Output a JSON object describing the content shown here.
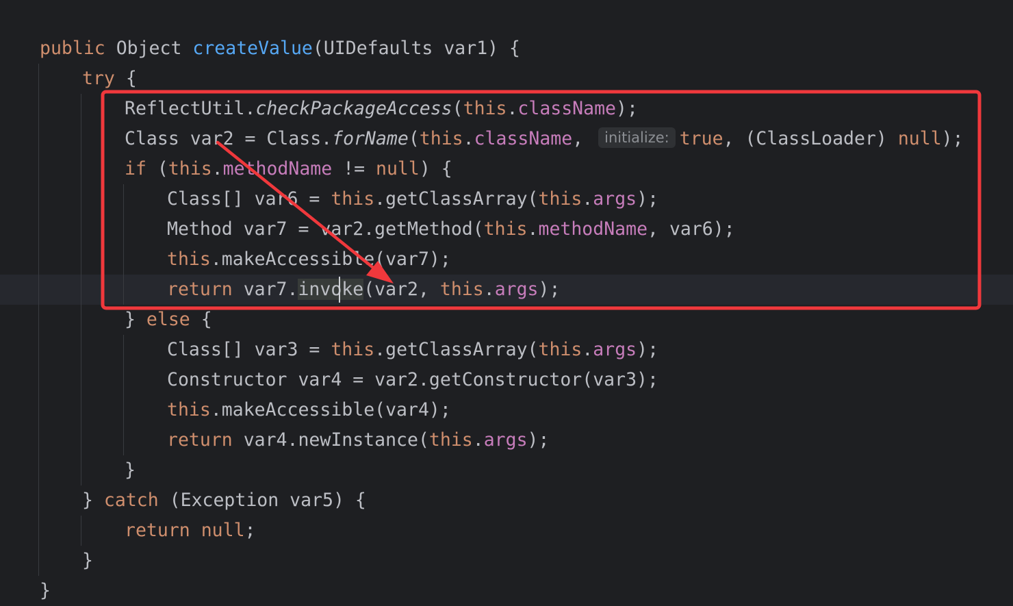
{
  "annotation": {
    "color": "#f0383c"
  },
  "code": {
    "lines": [
      {
        "indent": 0,
        "tokens": [
          {
            "t": "public",
            "c": "kw"
          },
          {
            "t": " Object ",
            "c": "plain"
          },
          {
            "t": "createValue",
            "c": "fn"
          },
          {
            "t": "(UIDefaults var1) {",
            "c": "plain"
          }
        ]
      },
      {
        "indent": 1,
        "tokens": [
          {
            "t": "try",
            "c": "kw"
          },
          {
            "t": " {",
            "c": "plain"
          }
        ]
      },
      {
        "indent": 2,
        "tokens": [
          {
            "t": "ReflectUtil.",
            "c": "plain"
          },
          {
            "t": "checkPackageAccess",
            "c": "static"
          },
          {
            "t": "(",
            "c": "plain"
          },
          {
            "t": "this",
            "c": "kw"
          },
          {
            "t": ".",
            "c": "plain"
          },
          {
            "t": "className",
            "c": "field"
          },
          {
            "t": ");",
            "c": "plain"
          }
        ]
      },
      {
        "indent": 2,
        "tokens": [
          {
            "t": "Class var2 = Class.",
            "c": "plain"
          },
          {
            "t": "forName",
            "c": "static"
          },
          {
            "t": "(",
            "c": "plain"
          },
          {
            "t": "this",
            "c": "kw"
          },
          {
            "t": ".",
            "c": "plain"
          },
          {
            "t": "className",
            "c": "field"
          },
          {
            "t": ", ",
            "c": "plain"
          },
          {
            "t": "initialize:",
            "c": "hint"
          },
          {
            "t": "true",
            "c": "kw"
          },
          {
            "t": ", (ClassLoader) ",
            "c": "plain"
          },
          {
            "t": "null",
            "c": "kw"
          },
          {
            "t": ");",
            "c": "plain"
          }
        ]
      },
      {
        "indent": 2,
        "tokens": [
          {
            "t": "if",
            "c": "kw"
          },
          {
            "t": " (",
            "c": "plain"
          },
          {
            "t": "this",
            "c": "kw"
          },
          {
            "t": ".",
            "c": "plain"
          },
          {
            "t": "methodName",
            "c": "field"
          },
          {
            "t": " != ",
            "c": "plain"
          },
          {
            "t": "null",
            "c": "kw"
          },
          {
            "t": ") {",
            "c": "plain"
          }
        ]
      },
      {
        "indent": 3,
        "tokens": [
          {
            "t": "Class[] var6 = ",
            "c": "plain"
          },
          {
            "t": "this",
            "c": "kw"
          },
          {
            "t": ".getClassArray(",
            "c": "plain"
          },
          {
            "t": "this",
            "c": "kw"
          },
          {
            "t": ".",
            "c": "plain"
          },
          {
            "t": "args",
            "c": "field"
          },
          {
            "t": ");",
            "c": "plain"
          }
        ]
      },
      {
        "indent": 3,
        "tokens": [
          {
            "t": "Method var7 = var2.getMethod(",
            "c": "plain"
          },
          {
            "t": "this",
            "c": "kw"
          },
          {
            "t": ".",
            "c": "plain"
          },
          {
            "t": "methodName",
            "c": "field"
          },
          {
            "t": ", var6);",
            "c": "plain"
          }
        ]
      },
      {
        "indent": 3,
        "tokens": [
          {
            "t": "this",
            "c": "kw"
          },
          {
            "t": ".makeAccessible(var7);",
            "c": "plain"
          }
        ]
      },
      {
        "indent": 3,
        "current": true,
        "tokens": [
          {
            "t": "return",
            "c": "kw"
          },
          {
            "t": " var7.",
            "c": "plain"
          },
          {
            "t": "invoke",
            "c": "hl"
          },
          {
            "t": "(var2, ",
            "c": "plain"
          },
          {
            "t": "this",
            "c": "kw"
          },
          {
            "t": ".",
            "c": "plain"
          },
          {
            "t": "args",
            "c": "field"
          },
          {
            "t": ");",
            "c": "plain"
          }
        ]
      },
      {
        "indent": 2,
        "tokens": [
          {
            "t": "} ",
            "c": "plain"
          },
          {
            "t": "else",
            "c": "kw"
          },
          {
            "t": " {",
            "c": "plain"
          }
        ]
      },
      {
        "indent": 3,
        "tokens": [
          {
            "t": "Class[] var3 = ",
            "c": "plain"
          },
          {
            "t": "this",
            "c": "kw"
          },
          {
            "t": ".getClassArray(",
            "c": "plain"
          },
          {
            "t": "this",
            "c": "kw"
          },
          {
            "t": ".",
            "c": "plain"
          },
          {
            "t": "args",
            "c": "field"
          },
          {
            "t": ");",
            "c": "plain"
          }
        ]
      },
      {
        "indent": 3,
        "tokens": [
          {
            "t": "Constructor var4 = var2.getConstructor(var3);",
            "c": "plain"
          }
        ]
      },
      {
        "indent": 3,
        "tokens": [
          {
            "t": "this",
            "c": "kw"
          },
          {
            "t": ".makeAccessible(var4);",
            "c": "plain"
          }
        ]
      },
      {
        "indent": 3,
        "tokens": [
          {
            "t": "return",
            "c": "kw"
          },
          {
            "t": " var4.newInstance(",
            "c": "plain"
          },
          {
            "t": "this",
            "c": "kw"
          },
          {
            "t": ".",
            "c": "plain"
          },
          {
            "t": "args",
            "c": "field"
          },
          {
            "t": ");",
            "c": "plain"
          }
        ]
      },
      {
        "indent": 2,
        "tokens": [
          {
            "t": "}",
            "c": "plain"
          }
        ]
      },
      {
        "indent": 1,
        "tokens": [
          {
            "t": "} ",
            "c": "plain"
          },
          {
            "t": "catch",
            "c": "kw"
          },
          {
            "t": " (Exception var5) {",
            "c": "plain"
          }
        ]
      },
      {
        "indent": 2,
        "tokens": [
          {
            "t": "return",
            "c": "kw"
          },
          {
            "t": " ",
            "c": "plain"
          },
          {
            "t": "null",
            "c": "kw"
          },
          {
            "t": ";",
            "c": "plain"
          }
        ]
      },
      {
        "indent": 1,
        "tokens": [
          {
            "t": "}",
            "c": "plain"
          }
        ]
      },
      {
        "indent": 0,
        "tokens": [
          {
            "t": "}",
            "c": "plain"
          }
        ]
      }
    ]
  }
}
